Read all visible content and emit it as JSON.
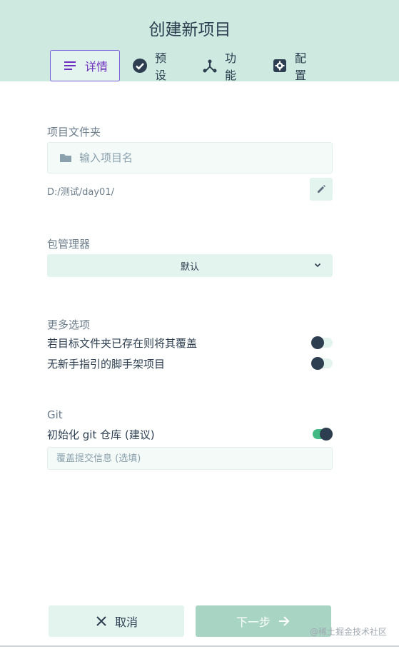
{
  "header": {
    "title": "创建新项目",
    "tabs": [
      {
        "label": "详情",
        "icon": "list-icon",
        "active": true
      },
      {
        "label": "预设",
        "icon": "check-circle-icon",
        "active": false
      },
      {
        "label": "功能",
        "icon": "fork-icon",
        "active": false
      },
      {
        "label": "配置",
        "icon": "settings-icon",
        "active": false
      }
    ]
  },
  "folder": {
    "label": "项目文件夹",
    "placeholder": "输入项目名",
    "path": "D:/测试/day01/",
    "icon": "folder-icon"
  },
  "package_manager": {
    "label": "包管理器",
    "selected": "默认"
  },
  "more_options": {
    "label": "更多选项",
    "items": [
      {
        "label": "若目标文件夹已存在则将其覆盖",
        "enabled": false
      },
      {
        "label": "无新手指引的脚手架项目",
        "enabled": false
      }
    ]
  },
  "git": {
    "label": "Git",
    "init_label": "初始化 git 仓库 (建议)",
    "init_enabled": true,
    "commit_placeholder": "覆盖提交信息 (选填)"
  },
  "footer": {
    "cancel_label": "取消",
    "next_label": "下一步"
  },
  "watermark": "@稀土掘金技术社区",
  "colors": {
    "accent": "#42b983",
    "header_bg": "#cde9e0",
    "active_tab": "#6d2dbf",
    "text": "#2c3e50"
  }
}
